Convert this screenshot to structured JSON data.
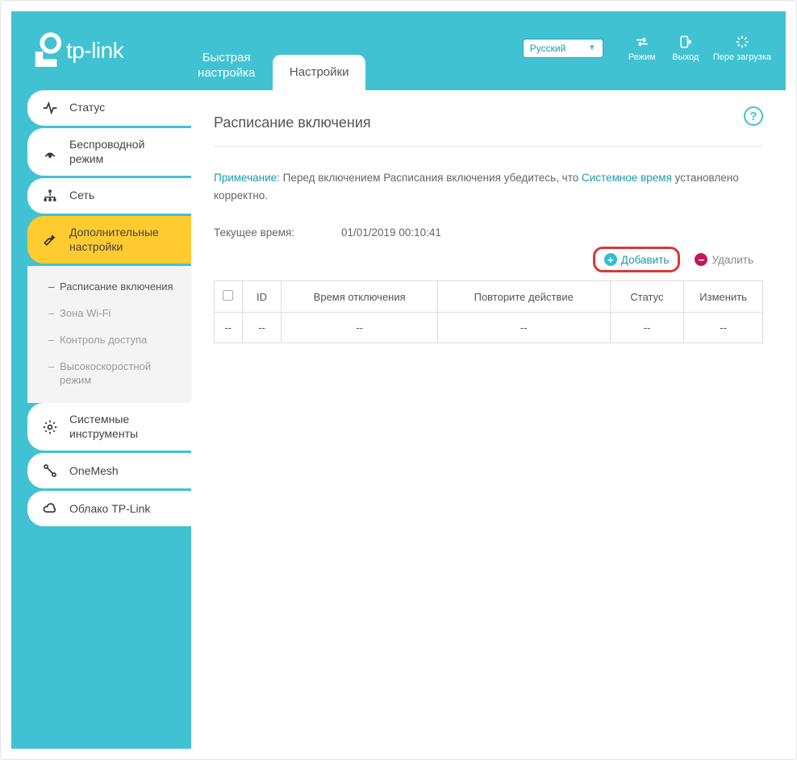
{
  "brand": "tp-link",
  "header": {
    "tabs": {
      "quick": "Быстрая\nнастройка",
      "settings": "Настройки"
    },
    "language": "Русский",
    "buttons": {
      "mode": "Режим",
      "logout": "Выход",
      "reboot": "Пере загрузка"
    }
  },
  "sidebar": {
    "status": "Статус",
    "wireless": "Беспроводной режим",
    "network": "Сеть",
    "advanced": "Дополнительные настройки",
    "sub": {
      "schedule": "Расписание включения",
      "wifi_zone": "Зона Wi-Fi",
      "access_control": "Контроль доступа",
      "high_speed": "Высокоскоростной режим"
    },
    "systools": "Системные инструменты",
    "onemesh": "OneMesh",
    "cloud": "Облако TP-Link"
  },
  "page": {
    "title": "Расписание включения",
    "note_label": "Примечание:",
    "note_before": "Перед включением Расписания включения убедитесь, что ",
    "note_link": "Системное время",
    "note_after": " установлено корректно.",
    "current_time_label": "Текущее время:",
    "current_time_value": "01/01/2019 00:10:41",
    "add_btn": "Добавить",
    "delete_btn": "Удалить",
    "table": {
      "cols": {
        "id": "ID",
        "off_time": "Время отключения",
        "repeat": "Повторите действие",
        "status": "Статус",
        "edit": "Изменить"
      },
      "empty": "--"
    }
  }
}
